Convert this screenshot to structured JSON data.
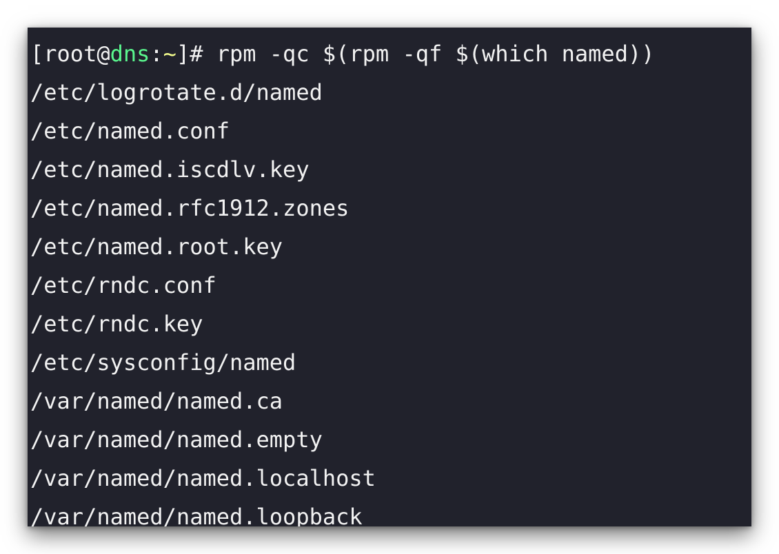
{
  "terminal": {
    "prompt": {
      "open_bracket": "[",
      "user": "root",
      "at": "@",
      "host": "dns",
      "colon": ":",
      "cwd": "~",
      "close_and_hash": "]# ",
      "command": "rpm -qc $(rpm -qf $(which named))"
    },
    "output": [
      "/etc/logrotate.d/named",
      "/etc/named.conf",
      "/etc/named.iscdlv.key",
      "/etc/named.rfc1912.zones",
      "/etc/named.root.key",
      "/etc/rndc.conf",
      "/etc/rndc.key",
      "/etc/sysconfig/named",
      "/var/named/named.ca",
      "/var/named/named.empty",
      "/var/named/named.localhost",
      "/var/named/named.loopback"
    ],
    "colors": {
      "background": "#21222c",
      "text": "#f2f2f2",
      "host": "#5af78e",
      "cwd": "#f1fa8c"
    }
  }
}
